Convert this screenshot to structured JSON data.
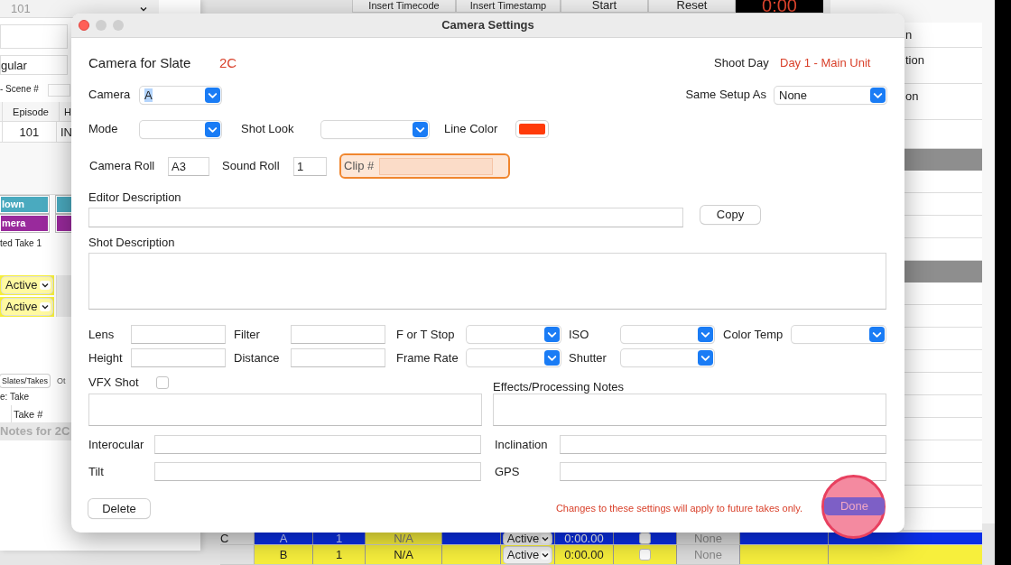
{
  "background": {
    "episode_field": {
      "value": "101"
    },
    "type_value": "gular",
    "scene_label": "- Scene #",
    "table_columns": [
      "Episode",
      "H"
    ],
    "table_row": [
      "101",
      "IN"
    ],
    "tag_buttons": [
      {
        "label": "lown",
        "color": "#4aaabf"
      },
      {
        "label": "mera",
        "color": "#992a9c"
      }
    ],
    "selected_take": {
      "label": "ted Take",
      "value": "1"
    },
    "status_selects": [
      "Active",
      "Active"
    ],
    "tabs": [
      {
        "label": "Slates/Takes",
        "selected": true
      },
      {
        "label": "Ot",
        "selected": false
      }
    ],
    "type_label": "e: Take",
    "take_column": "Take #",
    "notes_title": "Notes for 2C",
    "toolbar": [
      "Insert Timecode",
      "Insert Timestamp",
      "Start",
      "Reset"
    ],
    "timer": "0:00",
    "right_rows": [
      "n",
      "tion",
      "on"
    ],
    "takes_rows": [
      {
        "label": "C",
        "cells": [
          "A",
          "1",
          "N/A"
        ],
        "status": "Active",
        "time": "0:00.00",
        "checked": false,
        "sound": "None",
        "color": "#0a2ee6"
      },
      {
        "cells": [
          "B",
          "1",
          "N/A"
        ],
        "status": "Active",
        "time": "0:00.00",
        "checked": false,
        "sound": "None",
        "color": "#f7ef3c"
      }
    ]
  },
  "dialog": {
    "title": "Camera Settings",
    "slate": {
      "label": "Camera for Slate",
      "value": "2C"
    },
    "shoot_day": {
      "label": "Shoot Day",
      "value": "Day 1 - Main Unit"
    },
    "camera": {
      "label": "Camera",
      "value": "A",
      "text_selected": true
    },
    "same_setup": {
      "label": "Same Setup As",
      "value": "None"
    },
    "mode": {
      "label": "Mode"
    },
    "shot_look": {
      "label": "Shot Look"
    },
    "line_color": {
      "label": "Line Color",
      "color": "#ff3b0a"
    },
    "camera_roll": {
      "label": "Camera Roll",
      "value": "A3"
    },
    "sound_roll": {
      "label": "Sound Roll",
      "value": "1"
    },
    "clip": {
      "label": "Clip #",
      "highlighted": true
    },
    "editor_description": {
      "label": "Editor Description"
    },
    "copy_button": "Copy",
    "shot_description": {
      "label": "Shot Description"
    },
    "grid_rows": [
      [
        {
          "label": "Lens",
          "kind": "text"
        },
        {
          "label": "Filter",
          "kind": "text"
        },
        {
          "label": "F or T Stop",
          "kind": "select"
        },
        {
          "label": "ISO",
          "kind": "select"
        },
        {
          "label": "Color Temp",
          "kind": "select"
        }
      ],
      [
        {
          "label": "Height",
          "kind": "text"
        },
        {
          "label": "Distance",
          "kind": "text"
        },
        {
          "label": "Frame Rate",
          "kind": "select"
        },
        {
          "label": "Shutter",
          "kind": "select"
        }
      ]
    ],
    "vfx_shot": {
      "label": "VFX Shot",
      "checked": false
    },
    "effects_notes": {
      "label": "Effects/Processing Notes"
    },
    "pair_rows": [
      [
        {
          "label": "Interocular"
        },
        {
          "label": "Inclination"
        }
      ],
      [
        {
          "label": "Tilt"
        },
        {
          "label": "GPS"
        }
      ]
    ],
    "delete_button": "Delete",
    "notice": "Changes to these settings will apply to future takes only.",
    "done_button": "Done",
    "done_highlighted": true
  }
}
